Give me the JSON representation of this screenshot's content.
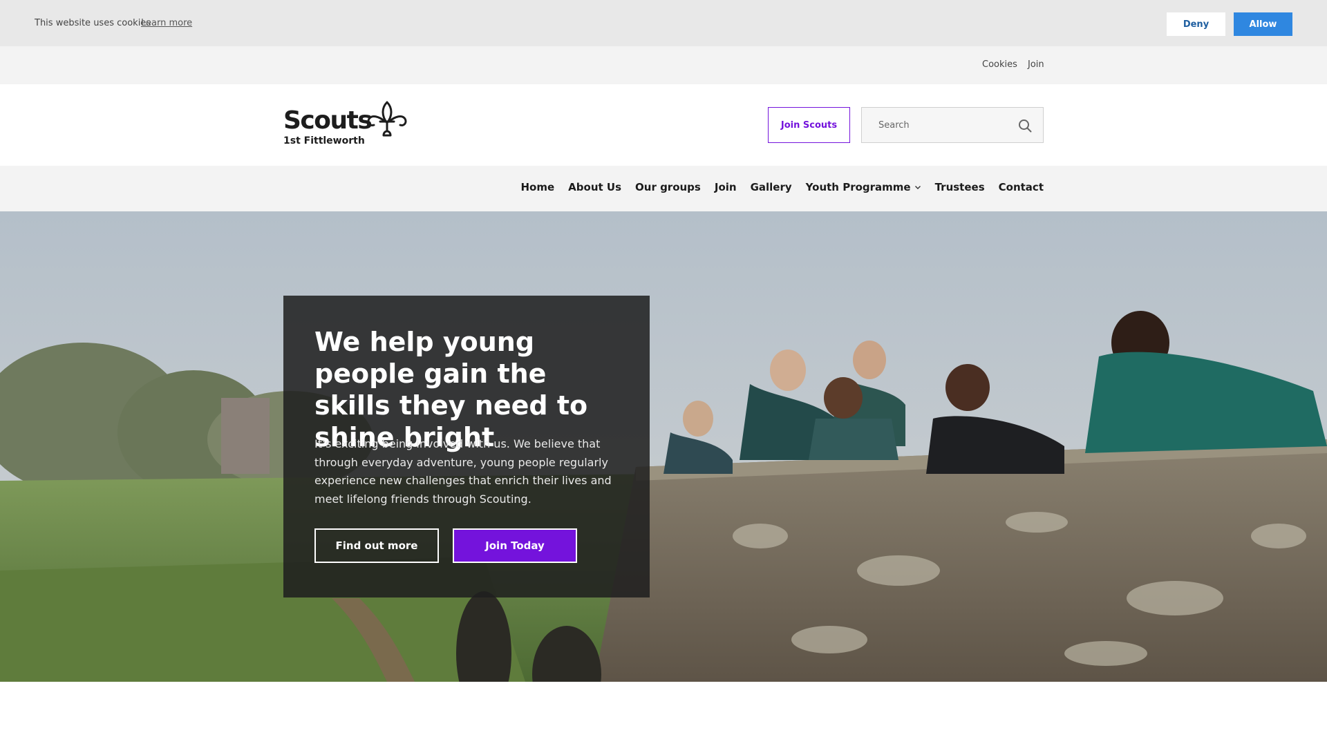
{
  "cookie_banner": {
    "message": "This website uses cookies",
    "learn_more": "Learn more",
    "deny": "Deny",
    "allow": "Allow"
  },
  "utility_nav": {
    "items": [
      "Cookies",
      "Join"
    ]
  },
  "header": {
    "logo_word": "Scouts",
    "logo_subtitle": "1st Fittleworth",
    "logo_icon": "fleur-de-lis-icon",
    "join_button": "Join Scouts",
    "search_placeholder": "Search",
    "search_icon": "search-icon"
  },
  "main_nav": {
    "items": [
      "Home",
      "About Us",
      "Our groups",
      "Join",
      "Gallery",
      "Youth Programme",
      "Trustees",
      "Contact"
    ],
    "dropdown_icon": "chevron-down-icon"
  },
  "hero": {
    "title": "We help young people gain the skills they need to shine bright",
    "body": "It’s exciting being involved with us. We believe that through everyday adventure, young people regularly experience new challenges that enrich their lives and meet lifelong friends through Scouting.",
    "primary_button": "Find out more",
    "secondary_button": "Join Today"
  },
  "colors": {
    "brand_purple": "#7413dc",
    "allow_blue": "#2f87e0",
    "cookie_bar_bg": "#e8e8e8",
    "nav_bg": "#f3f3f3",
    "panel_bg": "#1e1e1e"
  }
}
